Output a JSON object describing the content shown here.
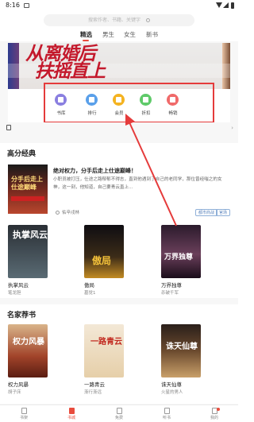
{
  "status_bar": {
    "time": "8:16"
  },
  "search": {
    "placeholder": "搜索作者、书籍、关键字"
  },
  "tabs": [
    {
      "label": "精选",
      "active": true
    },
    {
      "label": "男生",
      "active": false
    },
    {
      "label": "女生",
      "active": false
    },
    {
      "label": "新书",
      "active": false
    }
  ],
  "banner": {
    "line1": "从离婚后",
    "line2": "扶摇直上"
  },
  "quick_entries": [
    {
      "label": "书库",
      "icon": "library-icon",
      "color": "#8a7fe0"
    },
    {
      "label": "排行",
      "icon": "trophy-icon",
      "color": "#5aa0ea"
    },
    {
      "label": "会员",
      "icon": "crown-icon",
      "color": "#f4b321"
    },
    {
      "label": "折扣",
      "icon": "discount-icon",
      "color": "#5fca6a"
    },
    {
      "label": "畅销",
      "icon": "flame-icon",
      "color": "#f06a6a"
    }
  ],
  "section_classic": {
    "title": "高分经典",
    "featured": {
      "cover_text": "分手后走上仕途巅峰",
      "title": "绝对权力，分手后走上仕途巅峰！",
      "description": "小职员被打压，仕途之路郁郁不得志，直到他遇到了自己的老同学，那位曾经嗤之的女神，这一刻，他知道，自己要青云直上...",
      "author": "佑辛戌林",
      "tags": [
        "都市商战",
        "官场"
      ]
    },
    "books": [
      {
        "name": "执掌风云",
        "author": "笔龙胆",
        "cover_text": "执掌风云"
      },
      {
        "name": "傲局",
        "author": "墓觉1",
        "cover_text": "傲局"
      },
      {
        "name": "万界独尊",
        "author": "杀破千军",
        "cover_text": "万界独尊"
      }
    ]
  },
  "section_famous": {
    "title": "名家荐书",
    "books": [
      {
        "name": "权力风暴",
        "author": "胡子床",
        "cover_text": "权力风暴"
      },
      {
        "name": "一路青云",
        "author": "渐行渐远",
        "cover_text": "一路青云"
      },
      {
        "name": "诛天仙尊",
        "author": "火星的男人",
        "cover_text": "诛天仙尊"
      }
    ]
  },
  "bottom_nav": [
    {
      "label": "书架",
      "active": false
    },
    {
      "label": "书城",
      "active": true
    },
    {
      "label": "免费",
      "active": false
    },
    {
      "label": "听书",
      "active": false
    },
    {
      "label": "我的",
      "active": false
    }
  ],
  "colors": {
    "accent": "#e84c3d",
    "highlight_box": "#e53b3b"
  }
}
